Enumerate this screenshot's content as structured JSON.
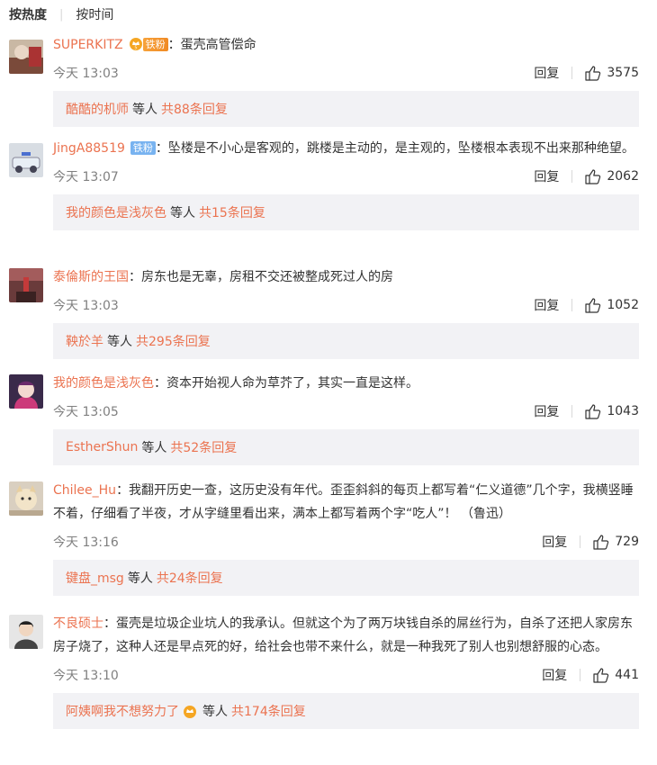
{
  "sort": {
    "hot": "按热度",
    "time": "按时间"
  },
  "comments": [
    {
      "user": "SUPERKITZ",
      "badge": "铁粉",
      "badge_style": "orange",
      "crown": true,
      "text": "：蛋壳高管偿命",
      "time": "今天 13:03",
      "reply": "回复",
      "likes": "3575",
      "sub_user": "酷酷的机师",
      "sub_mid": "等人",
      "sub_count": "共88条回复"
    },
    {
      "user": "JingA88519",
      "badge": "铁粉",
      "badge_style": "blue",
      "crown": false,
      "text": "：坠楼是不小心是客观的，跳楼是主动的，是主观的，坠楼根本表现不出来那种绝望。",
      "time": "今天 13:07",
      "reply": "回复",
      "likes": "2062",
      "sub_user": "我的颜色是浅灰色",
      "sub_mid": "等人",
      "sub_count": "共15条回复"
    },
    {
      "user": "泰倫斯的王国",
      "text": "：房东也是无辜，房租不交还被整成死过人的房",
      "time": "今天 13:03",
      "reply": "回复",
      "likes": "1052",
      "sub_user": "鞅於羊",
      "sub_mid": "等人",
      "sub_count": "共295条回复"
    },
    {
      "user": "我的颜色是浅灰色",
      "text": "：资本开始视人命为草芥了，其实一直是这样。",
      "time": "今天 13:05",
      "reply": "回复",
      "likes": "1043",
      "sub_user": "EstherShun",
      "sub_mid": "等人",
      "sub_count": "共52条回复"
    },
    {
      "user": "Chilee_Hu",
      "text": "：我翻开历史一查，这历史没有年代。歪歪斜斜的每页上都写着“仁义道德”几个字，我横竖睡不着，仔细看了半夜，才从字缝里看出来，满本上都写着两个字“吃人”！ （鲁迅）",
      "time": "今天 13:16",
      "reply": "回复",
      "likes": "729",
      "sub_user": "键盘_msg",
      "sub_mid": "等人",
      "sub_count": "共24条回复"
    },
    {
      "user": "不良硕士",
      "text": "：蛋壳是垃圾企业坑人的我承认。但就这个为了两万块钱自杀的屌丝行为，自杀了还把人家房东房子烧了，这种人还是早点死的好，给社会也带不来什么，就是一种我死了别人也别想舒服的心态。",
      "time": "今天 13:10",
      "reply": "回复",
      "likes": "441",
      "sub_user": "阿姨啊我不想努力了",
      "sub_mid": "等人",
      "sub_count": "共174条回复"
    }
  ],
  "icons": {
    "like": "thumbs-up-icon",
    "crown": "crown-badge-icon"
  },
  "colors": {
    "username": "#eb7350",
    "subreply_bg": "#f2f2f5",
    "meta": "#808080"
  }
}
